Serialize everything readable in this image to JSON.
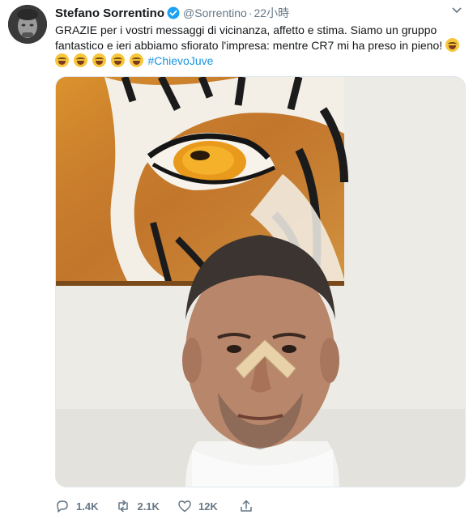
{
  "tweet": {
    "author_name": "Stefano Sorrentino",
    "handle": "@Sorrentino",
    "separator": "·",
    "time": "22小時",
    "text_line1": "GRAZIE per i vostri messaggi di vicinanza, affetto e stima. Siamo un gruppo",
    "text_line2": "fantastico e ieri abbiamo sfiorato l'impresa: mentre CR7 mi ha preso in pieno!",
    "hashtag": "#ChievoJuve",
    "emoji_name": "face-with-tears-of-joy"
  },
  "actions": {
    "replies": "1.4K",
    "retweets": "2.1K",
    "likes": "12K"
  },
  "colors": {
    "link": "#1b95e0",
    "verified": "#1da1f2",
    "muted": "#657786"
  }
}
